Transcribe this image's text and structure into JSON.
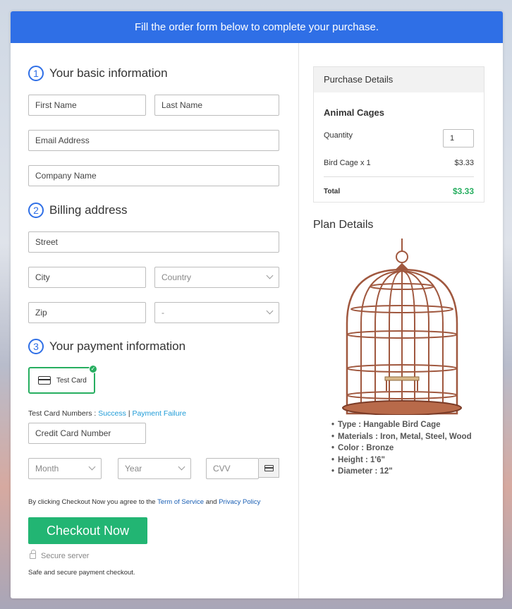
{
  "banner": "Fill the order form below to complete your purchase.",
  "sections": {
    "basic": {
      "num": "1",
      "title": "Your basic information"
    },
    "billing": {
      "num": "2",
      "title": "Billing address"
    },
    "payment": {
      "num": "3",
      "title": "Your payment information"
    }
  },
  "fields": {
    "first_name": "First Name",
    "last_name": "Last Name",
    "email": "Email Address",
    "company": "Company Name",
    "street": "Street",
    "city": "City",
    "country": "Country",
    "zip": "Zip",
    "state": "-",
    "card_number": "Credit Card Number",
    "month": "Month",
    "year": "Year",
    "cvv": "CVV"
  },
  "payment": {
    "card_label": "Test Card",
    "test_numbers_label": "Test Card Numbers :",
    "success": "Success",
    "separator": "|",
    "failure": "Payment Failure"
  },
  "terms": {
    "prefix": "By clicking Checkout Now you agree to the",
    "tos": "Term of Service",
    "and": "and",
    "privacy": "Privacy Policy"
  },
  "checkout_button": "Checkout Now",
  "secure_server": "Secure server",
  "secure_note": "Safe and secure payment checkout.",
  "purchase": {
    "header": "Purchase Details",
    "product": "Animal Cages",
    "quantity_label": "Quantity",
    "quantity": "1",
    "line_item": "Bird Cage x 1",
    "line_price": "$3.33",
    "total_label": "Total",
    "total_price": "$3.33"
  },
  "plan": {
    "title": "Plan Details",
    "details": [
      "Type : Hangable Bird Cage",
      "Materials : Iron, Metal, Steel, Wood",
      "Color : Bronze",
      "Height : 1'6\"",
      "Diameter : 12\""
    ]
  },
  "colors": {
    "accent": "#2f6fe6",
    "success": "#27ae60",
    "button": "#22b573",
    "cage": "#a0583f"
  }
}
